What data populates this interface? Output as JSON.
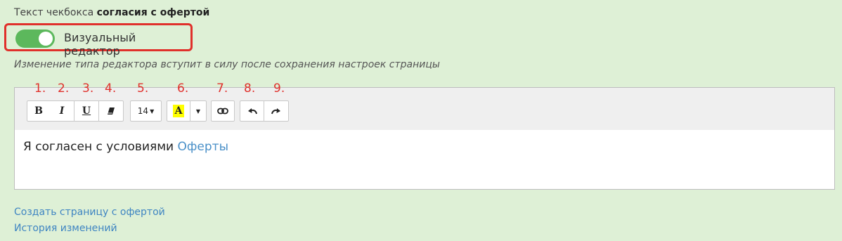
{
  "header": {
    "title_prefix": "Текст чекбокса",
    "title_bold": "согласия с офертой"
  },
  "toggle": {
    "label": "Визуальный редактор",
    "on": true
  },
  "note": "Изменение типа редактора вступит в силу после сохранения настроек страницы",
  "toolbar": {
    "annotations": [
      "1.",
      "2.",
      "3.",
      "4.",
      "5.",
      "6.",
      "7.",
      "8.",
      "9."
    ],
    "bold": "B",
    "italic": "I",
    "underline": "U",
    "font_size": "14",
    "color_letter": "A",
    "highlight_color": "#ffff00"
  },
  "content": {
    "text": "Я согласен с условиями",
    "link_text": "Оферты"
  },
  "footer": {
    "create_page_link": "Создать страницу с офертой",
    "history_link": "История изменений"
  },
  "colors": {
    "background": "#def0d6",
    "toggle_on": "#5cb85c",
    "highlight_border": "#e0302b",
    "link": "#3f85c2"
  }
}
